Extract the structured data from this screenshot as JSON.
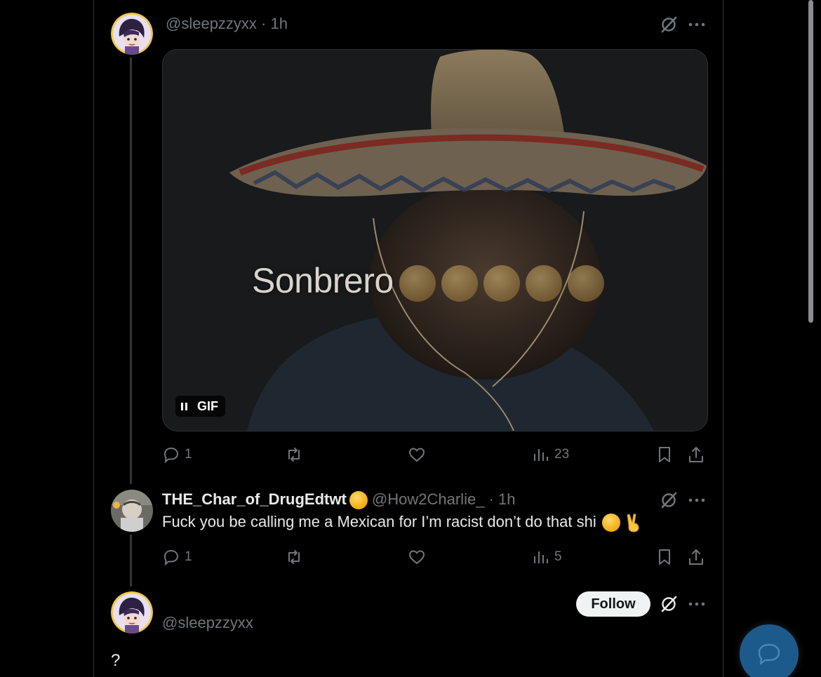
{
  "post1": {
    "handle": "@sleepzzyxx",
    "sep": " · ",
    "time": "1h",
    "media": {
      "caption": "Sonbrero",
      "badge_label": "GIF",
      "caption_emoji_count": 5
    },
    "stats": {
      "replies": "1",
      "reposts": "",
      "likes": "",
      "views": "23"
    }
  },
  "post2": {
    "display_name": "THE_Char_of_DrugEdtwt",
    "handle": "@How2Charlie_",
    "sep": " · ",
    "time": "1h",
    "text": "Fuck you be calling me a Mexican for I’m racist don’t do that shi",
    "stats": {
      "replies": "1",
      "reposts": "",
      "likes": "",
      "views": "5"
    }
  },
  "post3": {
    "handle": "@sleepzzyxx",
    "follow_label": "Follow",
    "text": "?"
  },
  "colors": {
    "background": "#000000",
    "muted": "#71767b",
    "text": "#e7e9ea",
    "follow_bg": "#eff3f4",
    "fab": "#1d5a8c"
  },
  "icons": [
    "grok-icon",
    "more-icon",
    "reply-icon",
    "repost-icon",
    "like-icon",
    "views-icon",
    "bookmark-icon",
    "share-icon",
    "pause-icon",
    "chat-icon"
  ]
}
